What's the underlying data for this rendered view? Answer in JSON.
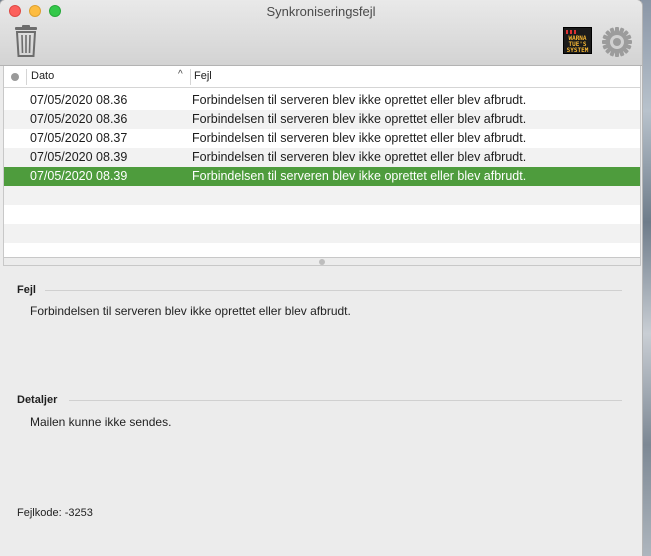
{
  "window": {
    "title": "Synkroniseringsfejl"
  },
  "toolbar": {
    "ticker_text": "WARNA TUE'S SYSTEM",
    "icons": [
      "trash-icon",
      "ticker-icon",
      "gear-icon"
    ]
  },
  "table": {
    "headers": {
      "status": "",
      "date": "Dato",
      "error": "Fejl"
    },
    "sort_indicator": "^",
    "rows": [
      {
        "date": "07/05/2020 08.36",
        "error": "Forbindelsen til serveren blev ikke oprettet eller blev afbrudt.",
        "selected": false
      },
      {
        "date": "07/05/2020 08.36",
        "error": "Forbindelsen til serveren blev ikke oprettet eller blev afbrudt.",
        "selected": false
      },
      {
        "date": "07/05/2020 08.37",
        "error": "Forbindelsen til serveren blev ikke oprettet eller blev afbrudt.",
        "selected": false
      },
      {
        "date": "07/05/2020 08.39",
        "error": "Forbindelsen til serveren blev ikke oprettet eller blev afbrudt.",
        "selected": false
      },
      {
        "date": "07/05/2020 08.39",
        "error": "Forbindelsen til serveren blev ikke oprettet eller blev afbrudt.",
        "selected": true
      }
    ]
  },
  "detail": {
    "error_heading": "Fejl",
    "error_text": "Forbindelsen til serveren blev ikke oprettet eller blev afbrudt.",
    "details_heading": "Detaljer",
    "details_text": "Mailen kunne ikke sendes.",
    "error_code": "Fejlkode: -3253"
  },
  "colors": {
    "selection": "#4e9c3d",
    "close": "#fc605c",
    "minimize": "#fdbc40",
    "maximize": "#34c84a"
  }
}
